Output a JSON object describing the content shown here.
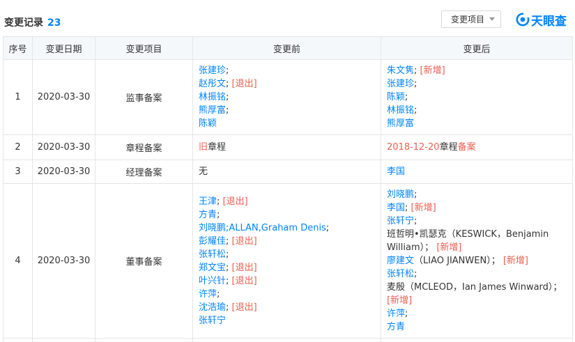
{
  "header": {
    "title": "变更记录",
    "count": "23",
    "filter_label": "变更项目",
    "logo_text": "天眼查"
  },
  "columns": [
    "序号",
    "变更日期",
    "变更项目",
    "变更前",
    "变更后"
  ],
  "rows": [
    {
      "index": "1",
      "date": "2020-03-30",
      "item": "监事备案",
      "before": [
        {
          "name": "张建珍",
          "sep": ";",
          "tag": ""
        },
        {
          "name": "赵彤文",
          "sep": ";",
          "tag": "[退出]"
        },
        {
          "name": "林振铭",
          "sep": ";",
          "tag": ""
        },
        {
          "name": "熊厚富",
          "sep": ";",
          "tag": ""
        },
        {
          "name": "陈颖",
          "sep": "",
          "tag": ""
        }
      ],
      "after": [
        {
          "name": "朱文隽",
          "sep": ";",
          "tag": "[新增]"
        },
        {
          "name": "张建珍",
          "sep": ";",
          "tag": ""
        },
        {
          "name": "陈颖",
          "sep": ";",
          "tag": ""
        },
        {
          "name": "林振铭",
          "sep": ";",
          "tag": ""
        },
        {
          "name": "熊厚富",
          "sep": "",
          "tag": ""
        }
      ]
    },
    {
      "index": "2",
      "date": "2020-03-30",
      "item": "章程备案",
      "before_parts": [
        "旧",
        "章程"
      ],
      "after_parts": [
        "2018-12-20",
        "章程",
        "备案"
      ]
    },
    {
      "index": "3",
      "date": "2020-03-30",
      "item": "经理备案",
      "before_text": "无",
      "after_name": "李国"
    },
    {
      "index": "4",
      "date": "2020-03-30",
      "item": "董事备案",
      "before": [
        {
          "name": "王津",
          "sep": ";",
          "tag": "[退出]"
        },
        {
          "name": "方青",
          "sep": ";",
          "tag": ""
        },
        {
          "name": "刘晓鹏;ALLAN,Graham Denis",
          "sep": ";",
          "tag": ""
        },
        {
          "name": "彭耀佳",
          "sep": ";",
          "tag": "[退出]"
        },
        {
          "name": "张轩松",
          "sep": ";",
          "tag": ""
        },
        {
          "name": "郑文宝",
          "sep": ";",
          "tag": "[退出]"
        },
        {
          "name": "叶兴针",
          "sep": ";",
          "tag": "[退出]"
        },
        {
          "name": "许萍",
          "sep": ";",
          "tag": ""
        },
        {
          "name": "沈浩瑜",
          "sep": ";",
          "tag": "[退出]"
        },
        {
          "name": "张轩宁",
          "sep": "",
          "tag": ""
        }
      ],
      "after": [
        {
          "name": "刘晓鹏",
          "sep": ";",
          "tag": "",
          "plain": false
        },
        {
          "name": "李国",
          "sep": ";",
          "tag": "[新增]",
          "plain": false
        },
        {
          "name": "张轩宁",
          "sep": ";",
          "tag": "",
          "plain": false
        },
        {
          "name": "班哲明•凯瑟克（KESWICK，Benjamin William）",
          "sep": "；",
          "tag": "[新增]",
          "plain": true
        },
        {
          "name": "廖建文",
          "sep": "（LIAO JIANWEN）；",
          "tag": "[新增]",
          "plain": false
        },
        {
          "name": "张轩松",
          "sep": ";",
          "tag": "",
          "plain": false
        },
        {
          "name": "麦殷（MCLEOD，Ian James Winward）",
          "sep": "；",
          "tag": "[新增]",
          "plain": true
        },
        {
          "name": "许萍",
          "sep": ";",
          "tag": "",
          "plain": false
        },
        {
          "name": "方青",
          "sep": "",
          "tag": "",
          "plain": false
        }
      ]
    }
  ]
}
